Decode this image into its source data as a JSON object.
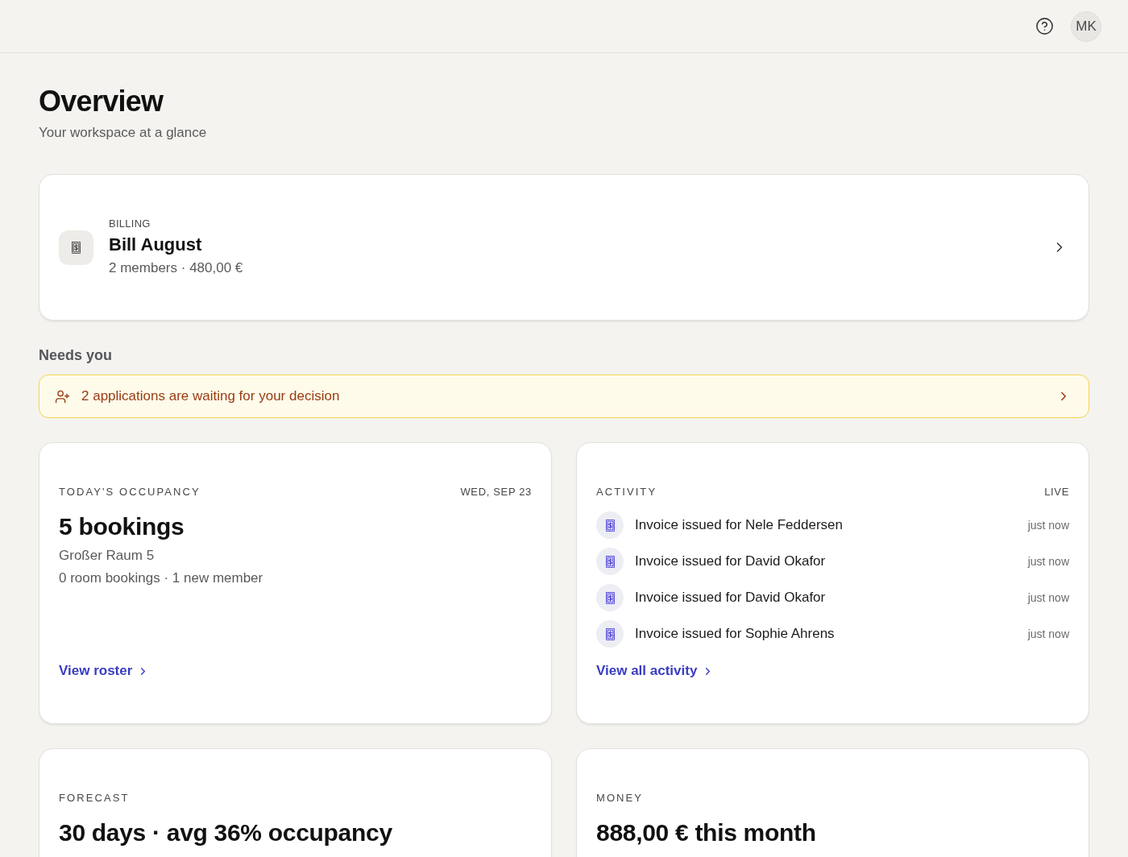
{
  "header": {
    "avatar_initials": "MK"
  },
  "page": {
    "title": "Overview",
    "subtitle": "Your workspace at a glance"
  },
  "billing_card": {
    "eyebrow": "BILLING",
    "title": "Bill August",
    "detail": "2 members · 480,00 €"
  },
  "needs_you": {
    "heading": "Needs you",
    "alerts": [
      {
        "text": "2 applications are waiting for your decision"
      }
    ]
  },
  "cards": [
    {
      "kind": "summary",
      "label": "TODAY'S OCCUPANCY",
      "aside": "WED, SEP 23",
      "title": "5 bookings",
      "lines": [
        "Großer Raum 5",
        "0 room bookings · 1 new member"
      ],
      "link": "View roster"
    },
    {
      "kind": "feed",
      "label": "ACTIVITY",
      "aside": "LIVE",
      "items": [
        {
          "text": "Invoice issued for Nele Feddersen",
          "time": "just now"
        },
        {
          "text": "Invoice issued for David Okafor",
          "time": "just now"
        },
        {
          "text": "Invoice issued for David Okafor",
          "time": "just now"
        },
        {
          "text": "Invoice issued for Sophie Ahrens",
          "time": "just now"
        }
      ],
      "link": "View all activity"
    },
    {
      "kind": "summary",
      "label": "FORECAST",
      "title": "30 days · avg 36% occupancy"
    },
    {
      "kind": "summary",
      "label": "MONEY",
      "title": "888,00 € this month"
    }
  ]
}
